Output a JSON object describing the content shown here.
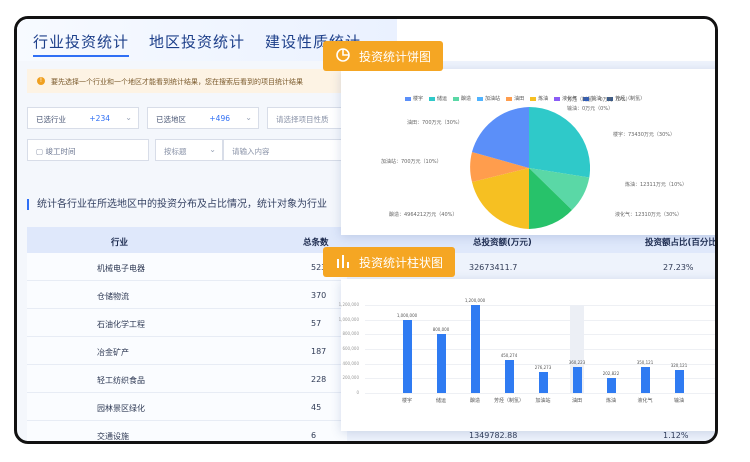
{
  "tabs": [
    {
      "label": "行业投资统计",
      "active": true
    },
    {
      "label": "地区投资统计",
      "active": false
    },
    {
      "label": "建设性质统计",
      "active": false
    }
  ],
  "notice": {
    "icon": "warning-icon",
    "text": "要先选择一个行业和一个地区才能看到统计结果，您在搜索后看到的项目统计结果"
  },
  "filters": {
    "industry": {
      "label": "已选行业",
      "count": "+234"
    },
    "region": {
      "label": "已选地区",
      "count": "+496"
    },
    "nature_placeholder": "请选择项目性质",
    "date_label": "竣工时间",
    "search_by": "按标题",
    "search_placeholder": "请输入内容"
  },
  "description": "统计各行业在所选地区中的投资分布及占比情况，统计对象为行业",
  "table": {
    "headers": [
      "行业",
      "总条数",
      "总投资额(万元)",
      "投资额占比(百分比)"
    ],
    "rows": [
      {
        "industry": "机械电子电器",
        "count": "523",
        "amount": "32673411.7",
        "ratio": "27.23%"
      },
      {
        "industry": "仓储物流",
        "count": "370",
        "amount": "",
        "ratio": ""
      },
      {
        "industry": "石油化学工程",
        "count": "57",
        "amount": "",
        "ratio": ""
      },
      {
        "industry": "冶金矿产",
        "count": "187",
        "amount": "",
        "ratio": ""
      },
      {
        "industry": "轻工纺织食品",
        "count": "228",
        "amount": "",
        "ratio": ""
      },
      {
        "industry": "园林景区绿化",
        "count": "45",
        "amount": "",
        "ratio": ""
      },
      {
        "industry": "交通设施",
        "count": "6",
        "amount": "1349782.88",
        "ratio": "1.12%"
      }
    ]
  },
  "pie_card": {
    "title": "投资统计饼图",
    "icon": "pie-chart-icon",
    "legend": [
      {
        "name": "楼宇",
        "color": "#5b8ff9"
      },
      {
        "name": "储运",
        "color": "#2fc9c9"
      },
      {
        "name": "酿造",
        "color": "#5ad8a6"
      },
      {
        "name": "加油站",
        "color": "#4fb3ff"
      },
      {
        "name": "油田",
        "color": "#ff9d4d"
      },
      {
        "name": "炼油",
        "color": "#f6c022"
      },
      {
        "name": "液化气",
        "color": "#8b5cf6"
      },
      {
        "name": "输油",
        "color": "#1e5bd6"
      },
      {
        "name": "芳烃（制氢）",
        "color": "#355a8f"
      }
    ],
    "labels": [
      {
        "text": "芳烃（制氢）：0万元（0%）"
      },
      {
        "text": "输油：0万元（0%）"
      },
      {
        "text": "油田：700万元（30%）"
      },
      {
        "text": "楼宇：73430万元（30%）"
      },
      {
        "text": "加油站：700万元（10%）"
      },
      {
        "text": "炼油：12311万元（10%）"
      },
      {
        "text": "酿造：4964212万元（40%）"
      },
      {
        "text": "液化气：12310万元（30%）"
      }
    ]
  },
  "bar_card": {
    "title": "投资统计柱状图",
    "icon": "bar-chart-icon"
  },
  "chart_data": {
    "type": "bar",
    "categories": [
      "楼宇",
      "储运",
      "酿造",
      "芳烃（制氢）",
      "加油站",
      "油田",
      "炼油",
      "液化气",
      "输油"
    ],
    "values": [
      1000000,
      800000,
      1200000,
      450000,
      280000,
      360000,
      200000,
      350000,
      320000
    ],
    "value_labels": [
      "1,000,000",
      "800,000",
      "1,200,000",
      "450,274",
      "276,273",
      "360,223",
      "202,822",
      "350,121",
      "320,121"
    ],
    "yticks": [
      "1,200,000",
      "1,000,000",
      "800,000",
      "600,000",
      "400,000",
      "200,000",
      "0"
    ],
    "ylim": [
      0,
      1200000
    ],
    "highlight_index": 5,
    "xlabel": "",
    "ylabel": "",
    "title": ""
  }
}
